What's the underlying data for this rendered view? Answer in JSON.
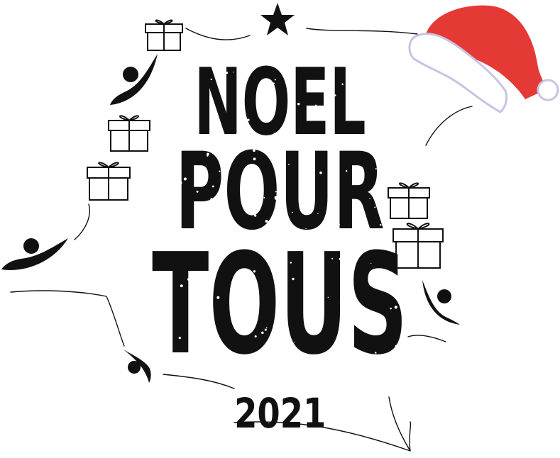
{
  "logo": {
    "line1": "NOEL",
    "line2": "POUR",
    "line3": "TOUS",
    "year": "2021"
  },
  "colors": {
    "ink": "#111111",
    "hat_red": "#e53935",
    "hat_fur": "#ffffff",
    "hat_fur_shadow": "#c9c3e3"
  },
  "icons": [
    "star-icon",
    "gift-icon",
    "figure-icon",
    "santa-hat-icon"
  ]
}
